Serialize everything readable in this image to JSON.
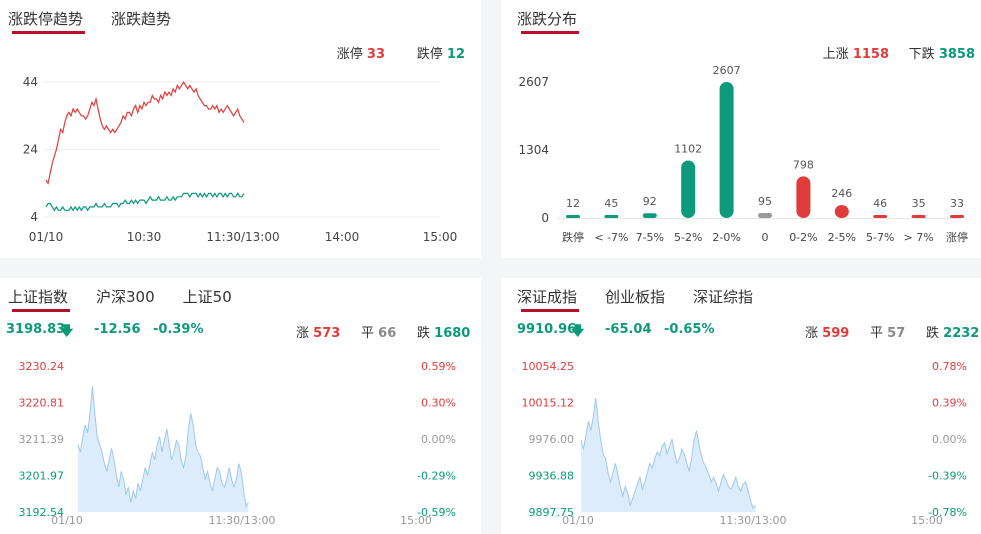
{
  "colors": {
    "red": "#e03c3c",
    "green": "#0c9a7a",
    "grey": "#9a9a9a",
    "accent": "#b7102b",
    "area": "#ddecfb",
    "areaLine": "#9ec8ee"
  },
  "p1": {
    "tabs": [
      "涨跌停趋势",
      "涨跌趋势"
    ],
    "limit_up_label": "涨停",
    "limit_up_value": "33",
    "limit_down_label": "跌停",
    "limit_down_value": "12",
    "chart_data": {
      "type": "line",
      "yticks": [
        "44",
        "24",
        "4"
      ],
      "ylim": [
        4,
        44
      ],
      "xticks": [
        "01/10",
        "10:30",
        "11:30/13:00",
        "14:00",
        "15:00"
      ],
      "series": [
        {
          "values": [
            15,
            14,
            17,
            20,
            22,
            24,
            27,
            30,
            29,
            32,
            34,
            35,
            34,
            36,
            35,
            36,
            35,
            34,
            34,
            33,
            34,
            36,
            38,
            37,
            39,
            36,
            33,
            31,
            30,
            31,
            30,
            29,
            30,
            29,
            30,
            31,
            32,
            34,
            33,
            35,
            35,
            34,
            36,
            37,
            35,
            37,
            36,
            38,
            37,
            38,
            38,
            40,
            39,
            39,
            38,
            40,
            39,
            41,
            40,
            41,
            40,
            42,
            41,
            43,
            42,
            43,
            44,
            43,
            42,
            43,
            42,
            41,
            42,
            40,
            39,
            38,
            37,
            37,
            36,
            36,
            37,
            36,
            37,
            35,
            36,
            35,
            36,
            37,
            36,
            35,
            34,
            35,
            36,
            34,
            33,
            32
          ]
        },
        {
          "values": [
            7,
            8,
            8,
            7,
            6,
            7,
            6,
            6,
            7,
            6,
            6,
            6,
            7,
            6,
            7,
            6,
            7,
            6,
            7,
            7,
            6,
            7,
            7,
            7,
            8,
            7,
            7,
            7,
            8,
            7,
            7,
            7,
            8,
            8,
            8,
            7,
            8,
            8,
            9,
            8,
            8,
            9,
            8,
            9,
            8,
            9,
            9,
            9,
            8,
            9,
            10,
            9,
            9,
            9,
            10,
            9,
            9,
            9,
            10,
            9,
            9,
            10,
            9,
            10,
            10,
            10,
            11,
            11,
            11,
            10,
            11,
            11,
            11,
            10,
            11,
            10,
            11,
            10,
            11,
            11,
            10,
            11,
            10,
            11,
            11,
            10,
            11,
            10,
            11,
            11,
            10,
            10,
            11,
            10,
            10,
            11
          ]
        }
      ]
    }
  },
  "p2": {
    "title": "涨跌分布",
    "up_label": "上涨",
    "up_value": "1158",
    "down_label": "下跌",
    "down_value": "3858",
    "chart_data": {
      "type": "bar",
      "yticks": [
        "2607",
        "1304",
        "0"
      ],
      "ylim": [
        0,
        2607
      ],
      "categories": [
        "跌停",
        "< -7%",
        "7-5%",
        "5-2%",
        "2-0%",
        "0",
        "0-2%",
        "2-5%",
        "5-7%",
        "> 7%",
        "涨停"
      ],
      "values": [
        12,
        45,
        92,
        1102,
        2607,
        95,
        798,
        246,
        46,
        35,
        33
      ],
      "colors": [
        "green",
        "green",
        "green",
        "green",
        "green",
        "grey",
        "red",
        "red",
        "red",
        "red",
        "red"
      ]
    }
  },
  "p3": {
    "tabs": [
      "上证指数",
      "沪深300",
      "上证50"
    ],
    "price": "3198.83",
    "change": "-12.56",
    "pct": "-0.39%",
    "up_label": "涨",
    "up_value": "573",
    "flat_label": "平",
    "flat_value": "66",
    "down_label": "跌",
    "down_value": "1680",
    "chart_data": {
      "type": "area",
      "yticks": [
        "3230.24",
        "3220.81",
        "3211.39",
        "3201.97",
        "3192.54"
      ],
      "yticks_right": [
        "0.59%",
        "0.30%",
        "0.00%",
        "-0.29%",
        "-0.59%"
      ],
      "ylim": [
        3192.54,
        3230.24
      ],
      "xticks": [
        "01/10",
        "11:30/13:00",
        "15:00"
      ],
      "values": [
        3210,
        3208,
        3212,
        3215,
        3213,
        3218,
        3225,
        3218,
        3212,
        3210,
        3208,
        3205,
        3203,
        3206,
        3209,
        3206,
        3202,
        3199,
        3203,
        3201,
        3197,
        3199,
        3195,
        3198,
        3196,
        3200,
        3198,
        3201,
        3204,
        3202,
        3205,
        3208,
        3206,
        3210,
        3212,
        3208,
        3211,
        3214,
        3210,
        3206,
        3208,
        3211,
        3210,
        3206,
        3204,
        3207,
        3214,
        3218,
        3215,
        3210,
        3208,
        3207,
        3204,
        3201,
        3203,
        3200,
        3198,
        3201,
        3204,
        3203,
        3200,
        3199,
        3201,
        3204,
        3201,
        3199,
        3201,
        3205,
        3203,
        3198,
        3194,
        3195
      ]
    }
  },
  "p4": {
    "tabs": [
      "深证成指",
      "创业板指",
      "深证综指"
    ],
    "price": "9910.96",
    "change": "-65.04",
    "pct": "-0.65%",
    "up_label": "涨",
    "up_value": "599",
    "flat_label": "平",
    "flat_value": "57",
    "down_label": "跌",
    "down_value": "2232",
    "chart_data": {
      "type": "area",
      "yticks": [
        "10054.25",
        "10015.12",
        "9976.00",
        "9936.88",
        "9897.75"
      ],
      "yticks_right": [
        "0.78%",
        "0.39%",
        "0.00%",
        "-0.39%",
        "-0.78%"
      ],
      "ylim": [
        9897.75,
        10054.25
      ],
      "xticks": [
        "01/10",
        "11:30/13:00",
        "15:00"
      ],
      "values": [
        9975,
        9965,
        9980,
        9995,
        9985,
        10000,
        10020,
        9995,
        9975,
        9960,
        9955,
        9940,
        9930,
        9940,
        9950,
        9938,
        9925,
        9915,
        9925,
        9918,
        9905,
        9912,
        9920,
        9928,
        9935,
        9922,
        9930,
        9940,
        9950,
        9945,
        9955,
        9962,
        9958,
        9968,
        9972,
        9960,
        9968,
        9976,
        9962,
        9950,
        9955,
        9965,
        9960,
        9950,
        9942,
        9955,
        9975,
        9985,
        9970,
        9958,
        9950,
        9945,
        9938,
        9930,
        9935,
        9928,
        9920,
        9930,
        9938,
        9932,
        9925,
        9922,
        9928,
        9935,
        9925,
        9920,
        9928,
        9930,
        9920,
        9910,
        9902,
        9905
      ]
    }
  }
}
